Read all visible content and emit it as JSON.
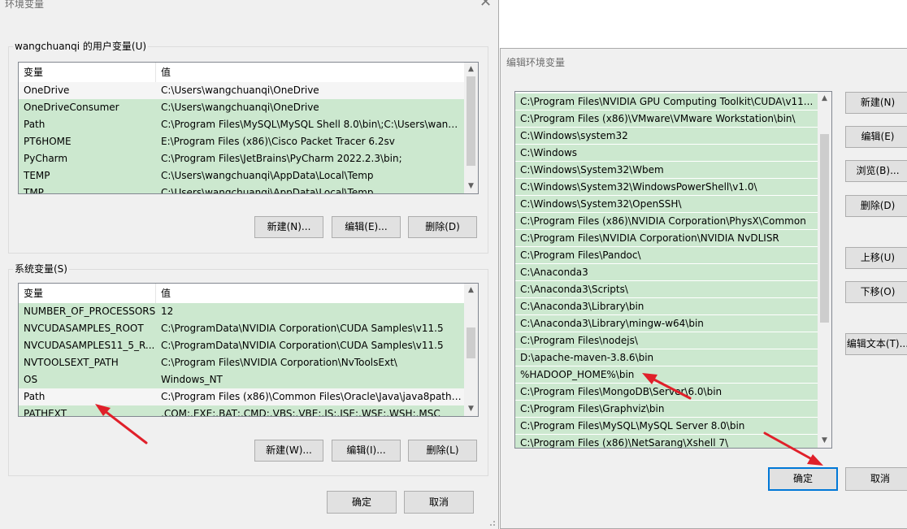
{
  "env_window": {
    "title": "环境变量",
    "user_group_label": "wangchuanqi 的用户变量(U)",
    "columns": [
      "变量",
      "值"
    ],
    "user_vars": [
      {
        "name": "OneDrive",
        "value": "C:\\Users\\wangchuanqi\\OneDrive"
      },
      {
        "name": "OneDriveConsumer",
        "value": "C:\\Users\\wangchuanqi\\OneDrive"
      },
      {
        "name": "Path",
        "value": "C:\\Program Files\\MySQL\\MySQL Shell 8.0\\bin\\;C:\\Users\\wang..."
      },
      {
        "name": "PT6HOME",
        "value": "E:\\Program Files (x86)\\Cisco Packet Tracer 6.2sv"
      },
      {
        "name": "PyCharm",
        "value": "C:\\Program Files\\JetBrains\\PyCharm 2022.2.3\\bin;"
      },
      {
        "name": "TEMP",
        "value": "C:\\Users\\wangchuanqi\\AppData\\Local\\Temp"
      },
      {
        "name": "TMP",
        "value": "C:\\Users\\wangchuanqi\\AppData\\Local\\Temp"
      }
    ],
    "user_buttons": {
      "new": "新建(N)...",
      "edit": "编辑(E)...",
      "delete": "删除(D)"
    },
    "system_group_label": "系统变量(S)",
    "system_vars": [
      {
        "name": "NUMBER_OF_PROCESSORS",
        "value": "12"
      },
      {
        "name": "NVCUDASAMPLES_ROOT",
        "value": "C:\\ProgramData\\NVIDIA Corporation\\CUDA Samples\\v11.5"
      },
      {
        "name": "NVCUDASAMPLES11_5_R...",
        "value": "C:\\ProgramData\\NVIDIA Corporation\\CUDA Samples\\v11.5"
      },
      {
        "name": "NVTOOLSEXT_PATH",
        "value": "C:\\Program Files\\NVIDIA Corporation\\NvToolsExt\\"
      },
      {
        "name": "OS",
        "value": "Windows_NT"
      },
      {
        "name": "Path",
        "value": "C:\\Program Files (x86)\\Common Files\\Oracle\\Java\\java8path;..."
      },
      {
        "name": "PATHEXT",
        "value": ".COM;.EXE;.BAT;.CMD;.VBS;.VBE;.JS;.JSE;.WSF;.WSH;.MSC"
      }
    ],
    "system_buttons": {
      "new": "新建(W)...",
      "edit": "编辑(I)...",
      "delete": "删除(L)"
    },
    "ok": "确定",
    "cancel": "取消"
  },
  "edit_window": {
    "title": "编辑环境变量",
    "paths": [
      "C:\\Program Files\\NVIDIA GPU Computing Toolkit\\CUDA\\v11...",
      "C:\\Program Files (x86)\\VMware\\VMware Workstation\\bin\\",
      "C:\\Windows\\system32",
      "C:\\Windows",
      "C:\\Windows\\System32\\Wbem",
      "C:\\Windows\\System32\\WindowsPowerShell\\v1.0\\",
      "C:\\Windows\\System32\\OpenSSH\\",
      "C:\\Program Files (x86)\\NVIDIA Corporation\\PhysX\\Common",
      "C:\\Program Files\\NVIDIA Corporation\\NVIDIA NvDLISR",
      "C:\\Program Files\\Pandoc\\",
      "C:\\Anaconda3",
      "C:\\Anaconda3\\Scripts\\",
      "C:\\Anaconda3\\Library\\bin",
      "C:\\Anaconda3\\Library\\mingw-w64\\bin",
      "C:\\Program Files\\nodejs\\",
      "D:\\apache-maven-3.8.6\\bin",
      "%HADOOP_HOME%\\bin",
      "C:\\Program Files\\MongoDB\\Server\\6.0\\bin",
      "C:\\Program Files\\Graphviz\\bin",
      "C:\\Program Files\\MySQL\\MySQL Server 8.0\\bin",
      "C:\\Program Files (x86)\\NetSarang\\Xshell 7\\"
    ],
    "buttons": {
      "new": "新建(N)",
      "edit": "编辑(E)",
      "browse": "浏览(B)...",
      "delete": "删除(D)",
      "move_up": "上移(U)",
      "move_down": "下移(O)",
      "edit_text": "编辑文本(T)..."
    },
    "ok": "确定",
    "cancel": "取消"
  },
  "colors": {
    "row_highlight": "#cce8cf",
    "annotation_arrow": "#e0202a",
    "default_button_border": "#0078d7"
  }
}
